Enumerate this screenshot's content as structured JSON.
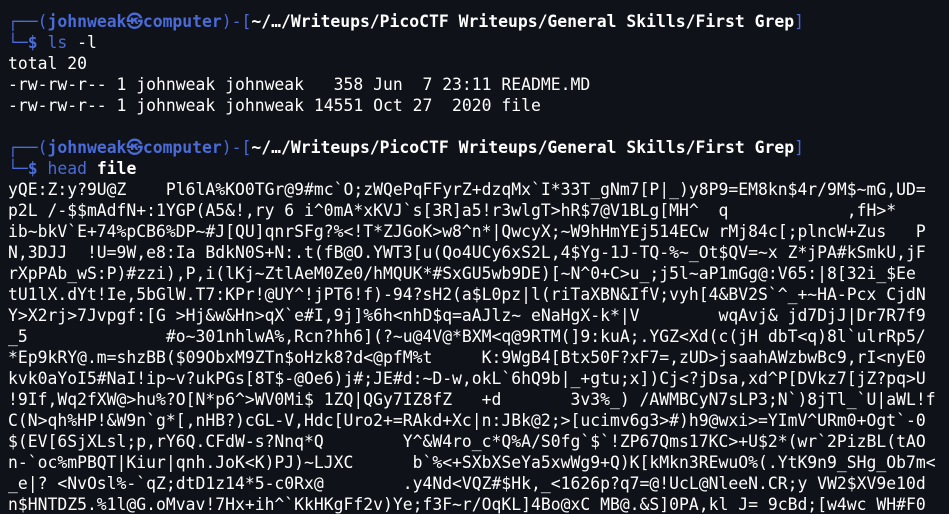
{
  "colors": {
    "background": "#0f1219",
    "prompt_accent": "#4a6bd8",
    "text": "#ffffff"
  },
  "prompts": [
    {
      "frame_top_left": "┌──(",
      "user": "johnweak",
      "skull": "㉿",
      "host": "computer",
      "frame_mid": ")-[",
      "path": "~/…/Writeups/PicoCTF Writeups/General Skills/First Grep",
      "frame_end": "]",
      "frame_bottom_left": "└─",
      "dollar": "$ ",
      "command": "ls",
      "args": " -l"
    },
    {
      "frame_top_left": "┌──(",
      "user": "johnweak",
      "skull": "㉿",
      "host": "computer",
      "frame_mid": ")-[",
      "path": "~/…/Writeups/PicoCTF Writeups/General Skills/First Grep",
      "frame_end": "]",
      "frame_bottom_left": "└─",
      "dollar": "$ ",
      "command": "head",
      "args": " file"
    }
  ],
  "ls_output": [
    "total 20",
    "-rw-rw-r-- 1 johnweak johnweak   358 Jun  7 23:11 README.MD",
    "-rw-rw-r-- 1 johnweak johnweak 14551 Oct 27  2020 file"
  ],
  "head_output": [
    "yQE:Z:y?9U@Z    Pl6lA%KO0TGr@9#mc`O;zWQePqFFyrZ+dzqMx`I*33T_gNm7[P|_)y8P9=EM8kn$4r/9M$~mG,UD=",
    "p2L /-$$mAdfN+:1YGP(A5&!,ry 6 i^0mA*xKVJ`s[3R]a5!r3wlgT>hR$7@V1BLg[MH^  q            ,fH>*",
    "ib~bkV`E+74%pCB6%DP~#J[QU]qnrSFg?%<!T*ZJGoK>w8^n*|QwcyX;~W9hHmYEj514ECw rMj84c[;plncW+Zus   P",
    "N,3DJJ  !U=9W,e8:Ia BdkN0S+N:.t(fB@O.YWT3[u(Qo4UCy6xS2L,4$Yg-1J-TQ-%~_Ot$QV=~x Z*jPA#kSmkU,jF",
    "rXpPAb_wS:P)#zzi),P,i(lKj~ZtlAeM0Ze0/hMQUK*#SxGU5wb9DE)[~N^0+C>u_;j5l~aP1mGg@:V65:|8[32i_$Ee",
    "tU1lX.dYt!Ie,5bGlW.T7:KPr!@UY^!jPT6!f)-94?sH2(a$L0pz|l(riTaXBN&IfV;vyh[4&BV2S`^_+~HA-Pcx CjdN",
    "Y>X2rj>7Jvpgf:[G >Hj&w&Hn>qX`e#I,9j]%6h<nhD$q=aAJlz~ eNaHgX-k*|V        wqAvj& jd7DjJ|Dr7R7f9",
    "_5              #o~301nhlwA%,Rcn?hh6](?~u@4V@*BXM<q@9RTM(]9:kuA;.YGZ<Xd(c(jH dbT<q)8l`ulrRp5/",
    "*Ep9kRY@.m=shzBB($09ObxM9ZTn$oHzk8?d<@pfM%t     K:9WgB4[Btx50F?xF7=,zUD>jsaahAWzbwBc9,rI<nyE0",
    "kvk0aYoI5#NaI!ip~v?ukPGs[8T$-@Oe6)j#;JE#d:~D-w,okL`6hQ9b|_+gtu;x])Cj<?jDsa,xd^P[DVkz7[jZ?pq>U",
    "!9If,Wq2fXW@>hu%?O[N*p6^>WV0Mi$ 1ZQ|QGy7IZ8fZ   +d       3v3%_) /AWMBCyN7sLP3;N`)8jTl_`U|aWL!f",
    "C(N>qh%HP!&W9n`g*[,nHB?)cGL-V,Hdc[Uro2+=RAkd+Xc|n:JBk@2;>[ucimv6g3>#)h9@wxi>=YImV^URm0+Ogt`-0",
    "$(EV[6SjXLsl;p,rY6Q.CFdW-s?Nnq*Q        Y^&W4ro_c*Q%A/S0fg`$`!ZP67Qms17KC>+U$2*(wr`2PizBL(tAO",
    "n-`oc%mPBQT|Kiur|qnh.JoK<K)PJ)~LJXC      b`%<+SXbXSeYa5xwWg9+Q)K[kMkn3REwuO%(.YtK9n9_SHg_Ob7m<",
    "_e|? <NvOsl%-`qZ;dtD1z14*5-c0Rx@        .y4Nd<VQZ#$Hk,_<1626p?q7=@!UcL@NleeN.CR;y VW2$XV9e10d",
    "n$HNTDZ5.%1l@G.oMvav!7Hx+ih^`KkHKgFf2v)Ye;f3F~r/OqKL]4Bo@xC MB@.&S]0PA,kl J= 9cBd;[w4wc WH#F0"
  ]
}
